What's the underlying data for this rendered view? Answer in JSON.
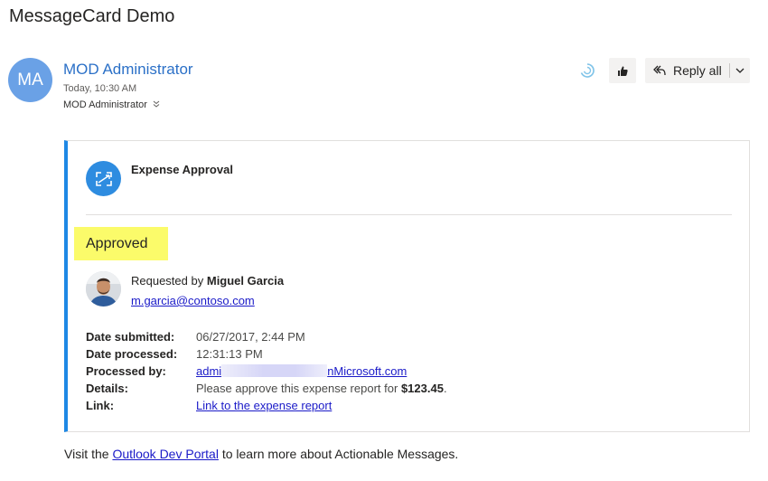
{
  "email": {
    "subject": "MessageCard Demo",
    "avatar_initials": "MA",
    "sender": "MOD Administrator",
    "time": "Today, 10:30 AM",
    "recipient": "MOD Administrator",
    "reply_all_label": "Reply all",
    "accent_color": "#2b70c7"
  },
  "card": {
    "title": "Expense Approval",
    "status": "Approved",
    "status_highlight_color": "#fbfb6a",
    "border_color": "#1e88e5",
    "requested_by_prefix": "Requested by",
    "requester_name": "Miguel Garcia",
    "requester_email": "m.garcia@contoso.com",
    "facts": {
      "date_submitted": {
        "label": "Date submitted:",
        "value": "06/27/2017, 2:44 PM"
      },
      "date_processed": {
        "label": "Date processed:",
        "value": "12:31:13 PM"
      },
      "processed_by": {
        "label": "Processed by:",
        "value_start": "admi",
        "value_end": "nMicrosoft.com"
      },
      "details": {
        "label": "Details:",
        "value_prefix": "Please approve this expense report for",
        "amount": "$123.45",
        "value_suffix": "."
      },
      "link": {
        "label": "Link:",
        "value": "Link to the expense report"
      }
    }
  },
  "footer": {
    "prefix": "Visit the",
    "link": "Outlook Dev Portal",
    "suffix": "to learn more about Actionable Messages."
  },
  "icons": {
    "status": "loading-ring-icon",
    "like": "thumbs-up-icon",
    "reply": "reply-all-icon",
    "dropdown": "chevron-down-icon",
    "card": "expand-arrows-icon"
  }
}
